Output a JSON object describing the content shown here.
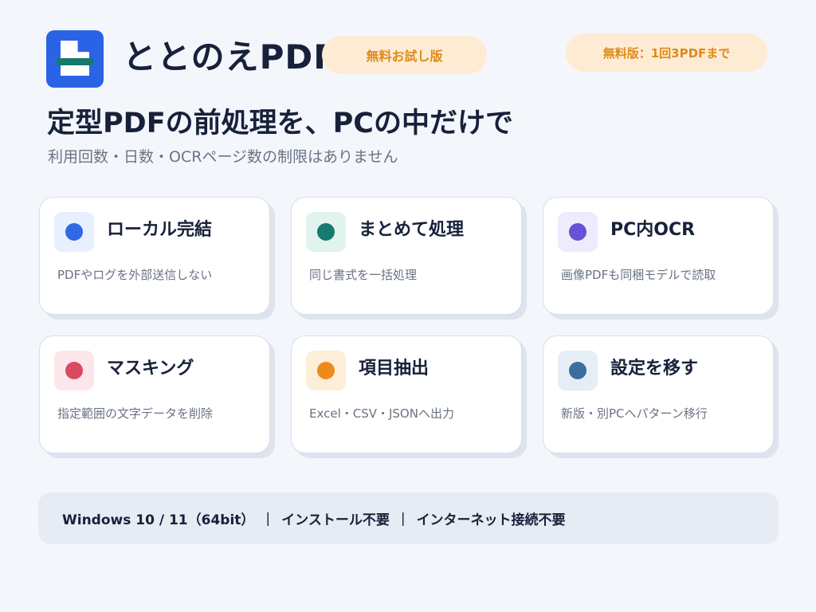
{
  "header": {
    "app_name": "ととのえPDF",
    "trial_badge": "無料お試し版",
    "limit_badge": "無料版：1回3PDFまで"
  },
  "hero": {
    "headline": "定型PDFの前処理を、PCの中だけで",
    "subline": "利用回数・日数・OCRページ数の制限はありません"
  },
  "features": [
    {
      "title": "ローカル完結",
      "desc": "PDFやログを外部送信しない",
      "icon": "local-dot-icon",
      "icon_color": "#2f6ae6",
      "icon_bg": "#e8efff"
    },
    {
      "title": "まとめて処理",
      "desc": "同じ書式を一括処理",
      "icon": "batch-dot-icon",
      "icon_color": "#167a6e",
      "icon_bg": "#e1f3ef"
    },
    {
      "title": "PC内OCR",
      "desc": "画像PDFも同梱モデルで読取",
      "icon": "ocr-dot-icon",
      "icon_color": "#6952d6",
      "icon_bg": "#eeebfd"
    },
    {
      "title": "マスキング",
      "desc": "指定範囲の文字データを削除",
      "icon": "mask-dot-icon",
      "icon_color": "#d94a60",
      "icon_bg": "#fde6ea"
    },
    {
      "title": "項目抽出",
      "desc": "Excel・CSV・JSONへ出力",
      "icon": "extract-dot-icon",
      "icon_color": "#ee8a1c",
      "icon_bg": "#fdeed8"
    },
    {
      "title": "設定を移す",
      "desc": "新版・別PCへパターン移行",
      "icon": "migrate-dot-icon",
      "icon_color": "#3d6d9e",
      "icon_bg": "#e5eef6"
    }
  ],
  "footer": {
    "os": "Windows 10 / 11（64bit）",
    "install": "インストール不要",
    "network": "インターネット接続不要",
    "separator": "|"
  }
}
